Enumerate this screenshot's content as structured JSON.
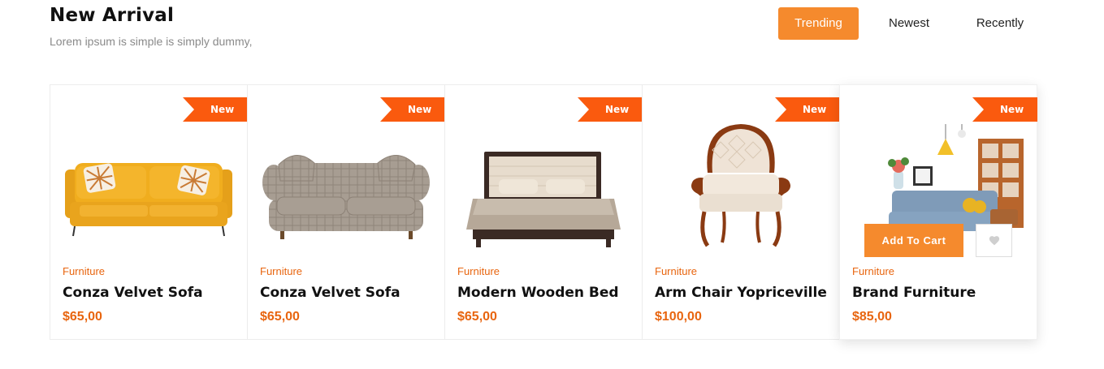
{
  "section": {
    "title": "New Arrival",
    "subtitle": "Lorem ipsum is simple is simply dummy,"
  },
  "tabs": [
    {
      "label": "Trending",
      "active": true
    },
    {
      "label": "Newest",
      "active": false
    },
    {
      "label": "Recently",
      "active": false
    }
  ],
  "colors": {
    "accent": "#f58a2d",
    "ribbon": "#fa5a0e",
    "price": "#e8650f"
  },
  "products": [
    {
      "badge": "New",
      "category": "Furniture",
      "name": "Conza Velvet Sofa",
      "price": "$65,00",
      "image": "yellow-sofa"
    },
    {
      "badge": "New",
      "category": "Furniture",
      "name": "Conza Velvet Sofa",
      "price": "$65,00",
      "image": "plaid-sofa"
    },
    {
      "badge": "New",
      "category": "Furniture",
      "name": "Modern Wooden Bed",
      "price": "$65,00",
      "image": "wooden-bed"
    },
    {
      "badge": "New",
      "category": "Furniture",
      "name": "Arm Chair Yopriceville",
      "price": "$100,00",
      "image": "arm-chair"
    },
    {
      "badge": "New",
      "category": "Furniture",
      "name": "Brand Furniture",
      "price": "$85,00",
      "image": "living-room-set"
    }
  ],
  "hover_card": {
    "add_to_cart": "Add To Cart",
    "wishlist_icon": "heart-icon"
  }
}
